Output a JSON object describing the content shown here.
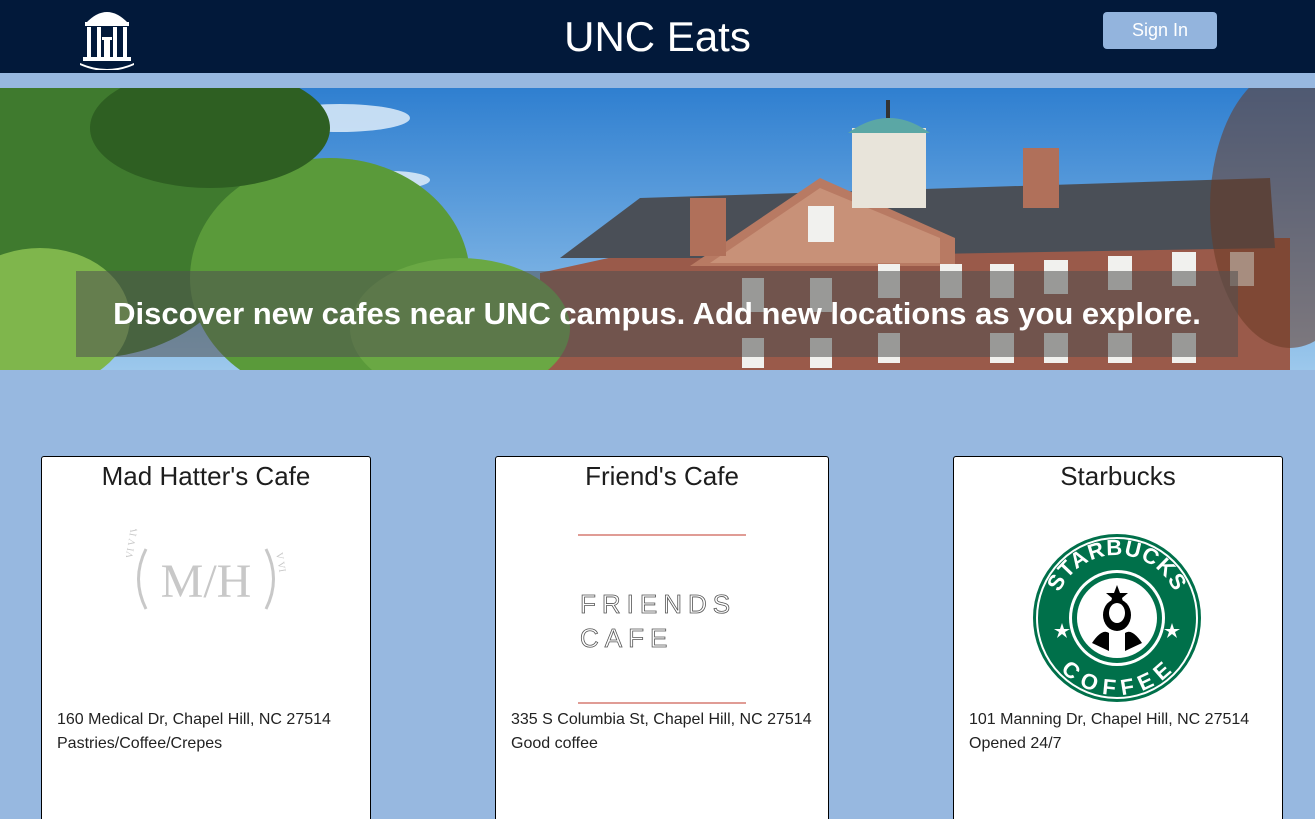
{
  "header": {
    "title": "UNC Eats",
    "sign_in_label": "Sign In",
    "logo_icon": "old-well-icon"
  },
  "hero": {
    "tagline": "Discover new cafes near UNC campus. Add new locations as you explore."
  },
  "cafes": [
    {
      "name": "Mad Hatter's Cafe",
      "address": "160 Medical Dr, Chapel Hill, NC 27514",
      "note": "Pastries/Coffee/Crepes",
      "logo_text": "M/H"
    },
    {
      "name": "Friend's Cafe",
      "address": "335 S Columbia St, Chapel Hill, NC 27514",
      "note": "Good coffee",
      "logo_line1": "FRIENDS",
      "logo_line2": "CAFE"
    },
    {
      "name": "Starbucks",
      "address": "101 Manning Dr, Chapel Hill, NC 27514",
      "note": "Opened 24/7",
      "logo_top": "STARBUCKS",
      "logo_bottom": "COFFEE"
    }
  ],
  "colors": {
    "header_bg": "#02193a",
    "page_bg": "#97b8e0",
    "button_bg": "#93b4dd",
    "starbucks_green": "#00704a"
  }
}
